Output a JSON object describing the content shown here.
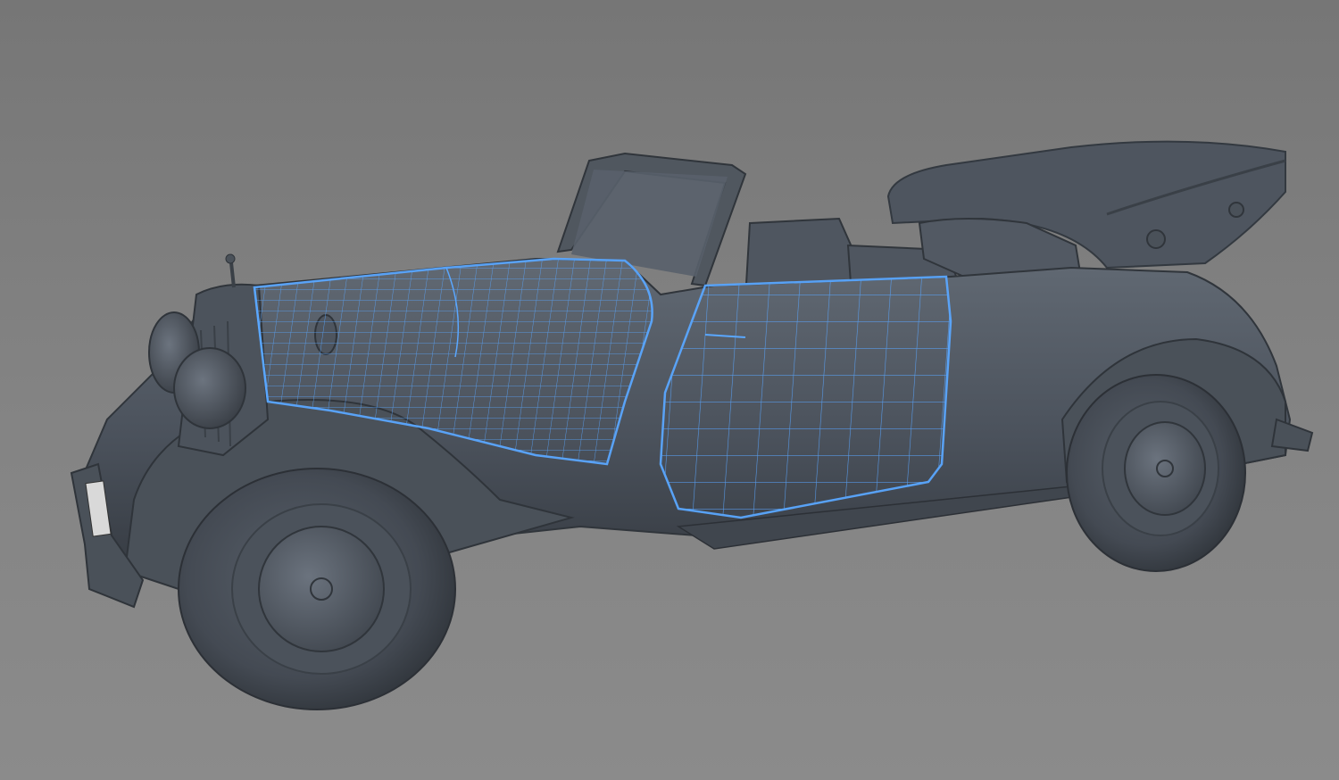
{
  "viewport": {
    "label": "",
    "background_top": "#767676",
    "background_bottom": "#8b8b8b"
  },
  "model": {
    "body_color": "#4b525c",
    "body_shadow": "#353a41",
    "body_highlight": "#69717c",
    "wireframe_color": "#5aa7ff",
    "selected_parts": [
      "hood-panel",
      "front-door-panel"
    ],
    "hood_state": "open",
    "roof_state": "folded"
  }
}
